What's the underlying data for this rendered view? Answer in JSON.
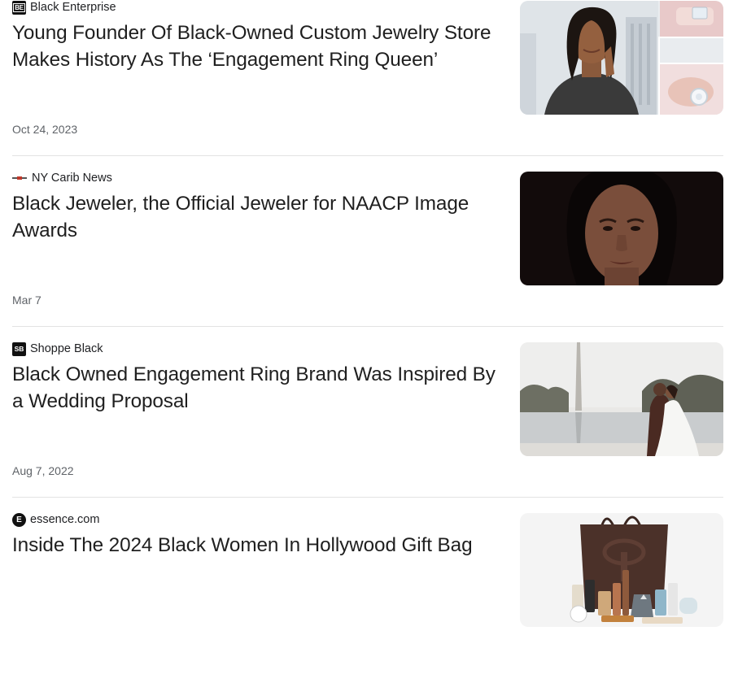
{
  "articles": [
    {
      "source": "Black Enterprise",
      "logo_text": "BE",
      "headline": "Young Founder Of Black-Owned Custom Jewelry Store Makes History As The ‘Engagement Ring Queen’",
      "date": "Oct 24, 2023"
    },
    {
      "source": "NY Carib News",
      "headline": "Black Jeweler, the Official Jeweler for NAACP Image Awards",
      "date": "Mar 7"
    },
    {
      "source": "Shoppe Black",
      "logo_text": "SB",
      "headline": "Black Owned Engagement Ring Brand Was Inspired By a Wedding Proposal",
      "date": "Aug 7, 2022"
    },
    {
      "source": "essence.com",
      "logo_text": "E",
      "headline": "Inside The 2024 Black Women In Hollywood Gift Bag"
    }
  ]
}
